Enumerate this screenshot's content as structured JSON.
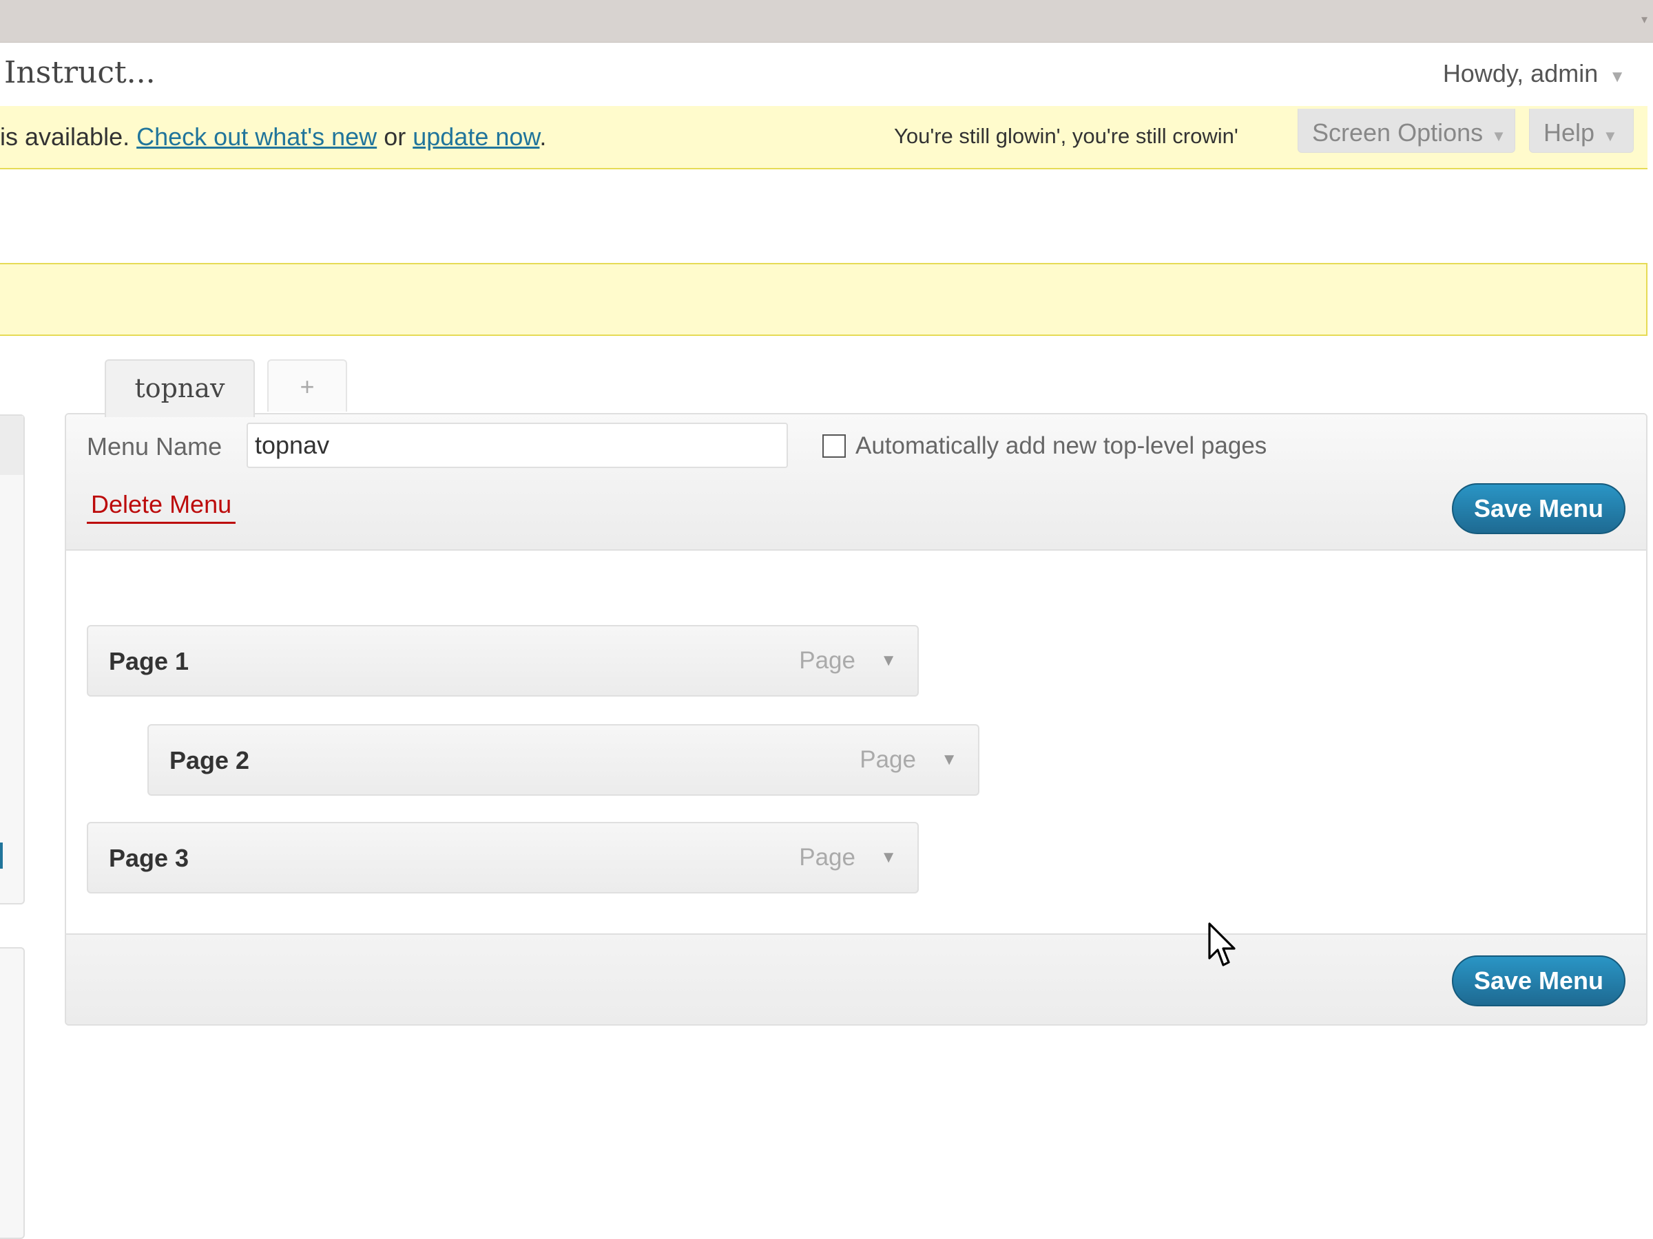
{
  "header": {
    "site_title": "Instruct...",
    "user_greeting": "Howdy, admin"
  },
  "update_notice": {
    "prefix": "is available.",
    "link_whats_new": "Check out what's new",
    "joiner": "or",
    "link_update_now": "update now",
    "suffix": "."
  },
  "hello_dolly": "You're still glowin', you're still crowin'",
  "screen_meta": {
    "screen_options_label": "Screen Options",
    "help_label": "Help"
  },
  "menu_tabs": {
    "active_tab": "topnav",
    "add_tab": "+"
  },
  "menu_editor": {
    "menu_name_label": "Menu Name",
    "menu_name_value": "topnav",
    "auto_add_label": "Automatically add new top-level pages",
    "auto_add_checked": false,
    "delete_label": "Delete Menu",
    "save_label": "Save Menu"
  },
  "menu_items": [
    {
      "title": "Page 1",
      "type": "Page",
      "depth": 0
    },
    {
      "title": "Page 2",
      "type": "Page",
      "depth": 1
    },
    {
      "title": "Page 3",
      "type": "Page",
      "depth": 0
    }
  ],
  "colors": {
    "accent": "#21759b",
    "notice_bg": "#fffbcc",
    "delete": "#bc0b0b"
  }
}
